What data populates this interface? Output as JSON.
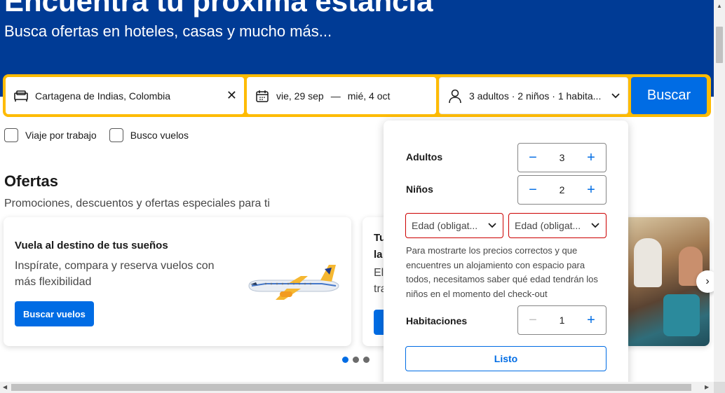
{
  "hero": {
    "title": "Encuentra tu próxima estancia",
    "subtitle": "Busca ofertas en hoteles, casas y mucho más..."
  },
  "search": {
    "destination": "Cartagena de Indias, Colombia",
    "checkin": "vie, 29 sep",
    "date_separator": "—",
    "checkout": "mié, 4 oct",
    "guests_summary": "3 adultos · 2 niños · 1 habita...",
    "button_label": "Buscar"
  },
  "checkboxes": [
    {
      "label": "Viaje por trabajo"
    },
    {
      "label": "Busco vuelos"
    }
  ],
  "offers": {
    "title": "Ofertas",
    "subtitle": "Promociones, descuentos y ofertas especiales para ti",
    "card1": {
      "title": "Vuela al destino de tus sueños",
      "text": "Inspírate, compara y reserva vuelos con más flexibilidad",
      "button": "Buscar vuelos"
    },
    "card2": {
      "title": "Tu\nla",
      "text": "Eli\ntra"
    }
  },
  "guests_panel": {
    "adults": {
      "label": "Adultos",
      "value": "3"
    },
    "children": {
      "label": "Niños",
      "value": "2"
    },
    "age_selects": [
      "Edad (obligat...",
      "Edad (obligat..."
    ],
    "note": "Para mostrarte los precios correctos y que encuentres un alojamiento con espacio para todos, necesitamos saber qué edad tendrán los niños en el momento del check-out",
    "rooms": {
      "label": "Habitaciones",
      "value": "1"
    },
    "done_label": "Listo"
  },
  "colors": {
    "brand_blue": "#003b95",
    "accent_yellow": "#febb02",
    "action_blue": "#006ce4",
    "error_red": "#cc0000"
  }
}
